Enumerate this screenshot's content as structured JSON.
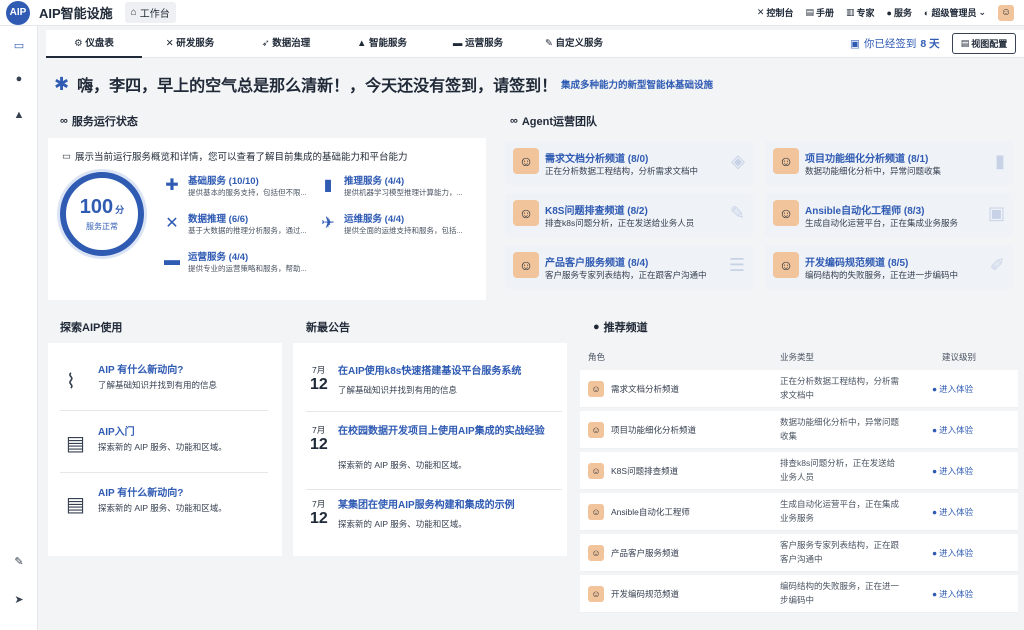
{
  "header": {
    "logo": "AIP",
    "title": "AIP智能设施",
    "workbench": "工作台",
    "nav": [
      {
        "label": "控制台",
        "icon": "tools-icon"
      },
      {
        "label": "手册",
        "icon": "book-icon"
      },
      {
        "label": "专家",
        "icon": "chart-icon"
      },
      {
        "label": "服务",
        "icon": "users-icon"
      }
    ],
    "user": "超级管理员"
  },
  "tabs": [
    "仪盘表",
    "研发服务",
    "数据治理",
    "智能服务",
    "运营服务",
    "自定义服务"
  ],
  "signin": {
    "prefix": "你已经签到",
    "days": "8 天"
  },
  "view_config": "视图配置",
  "greeting": {
    "text": "嗨，李四，早上的空气总是那么清新！，今天还没有签到，请签到！",
    "sub": "集成多种能力的新型智能体基础设施"
  },
  "status": {
    "title": "服务运行状态",
    "desc": "展示当前运行服务概览和详情，您可以查看了解目前集成的基础能力和平台能力",
    "score": "100",
    "unit": "分",
    "score_label": "服务正常",
    "services": [
      {
        "name": "基础服务",
        "count": "(10/10)",
        "desc": "提供基本的服务支持，包括但不限..."
      },
      {
        "name": "推理服务",
        "count": "(4/4)",
        "desc": "提供机器学习模型推理计算能力，..."
      },
      {
        "name": "数据推理",
        "count": "(6/6)",
        "desc": "基于大数据的推理分析服务，通过..."
      },
      {
        "name": "运维服务",
        "count": "(4/4)",
        "desc": "提供全面的运维支持和服务，包括..."
      },
      {
        "name": "运营服务",
        "count": "(4/4)",
        "desc": "提供专业的运营策略和服务，帮助..."
      }
    ]
  },
  "agents": {
    "title": "Agent运营团队",
    "items": [
      {
        "name": "需求文档分析频道",
        "count": "(8/0)",
        "desc": "正在分析数据工程结构，分析需求文档中"
      },
      {
        "name": "项目功能细化分析频道",
        "count": "(8/1)",
        "desc": "数据功能细化分析中，异常问题收集"
      },
      {
        "name": "K8S问题排查频道",
        "count": "(8/2)",
        "desc": "排查k8s问题分析，正在发送给业务人员"
      },
      {
        "name": "Ansible自动化工程师",
        "count": "(8/3)",
        "desc": "生成自动化运营平台，正在集成业务服务"
      },
      {
        "name": "产品客户服务频道",
        "count": "(8/4)",
        "desc": "客户服务专家列表结构，正在跟客户沟通中"
      },
      {
        "name": "开发编码规范频道",
        "count": "(8/5)",
        "desc": "编码结构的失败服务，正在进一步编码中"
      }
    ]
  },
  "explore": {
    "title": "探索AIP使用",
    "items": [
      {
        "title": "AIP 有什么新动向?",
        "desc": "了解基础知识并找到有用的信息"
      },
      {
        "title": "AIP入门",
        "desc": "探索新的 AIP 服务、功能和区域。"
      },
      {
        "title": "AIP 有什么新动向?",
        "desc": "探索新的 AIP 服务、功能和区域。"
      }
    ]
  },
  "news": {
    "title": "新最公告",
    "items": [
      {
        "month": "7月",
        "day": "12",
        "title": "在AIP使用k8s快速搭建基设平台服务系统",
        "desc": "了解基础知识并找到有用的信息"
      },
      {
        "month": "7月",
        "day": "12",
        "title": "在校园数据开发项目上使用AIP集成的实战经验",
        "desc": "探索新的 AIP 服务、功能和区域。"
      },
      {
        "month": "7月",
        "day": "12",
        "title": "某集团在使用AIP服务构建和集成的示例",
        "desc": "探索新的 AIP 服务、功能和区域。"
      }
    ]
  },
  "recommend": {
    "title": "推荐频道",
    "columns": [
      "角色",
      "业务类型",
      "建议级别"
    ],
    "action": "进入体验",
    "rows": [
      {
        "role": "需求文档分析频道",
        "type": "正在分析数据工程结构，分析需求文档中"
      },
      {
        "role": "项目功能细化分析频道",
        "type": "数据功能细化分析中，异常问题收集"
      },
      {
        "role": "K8S问题排查频道",
        "type": "排查k8s问题分析，正在发送给业务人员"
      },
      {
        "role": "Ansible自动化工程师",
        "type": "生成自动化运营平台，正在集成业务服务"
      },
      {
        "role": "产品客户服务频道",
        "type": "客户服务专家列表结构，正在跟客户沟通中"
      },
      {
        "role": "开发编码规范频道",
        "type": "编码结构的失败服务，正在进一步编码中"
      }
    ]
  }
}
